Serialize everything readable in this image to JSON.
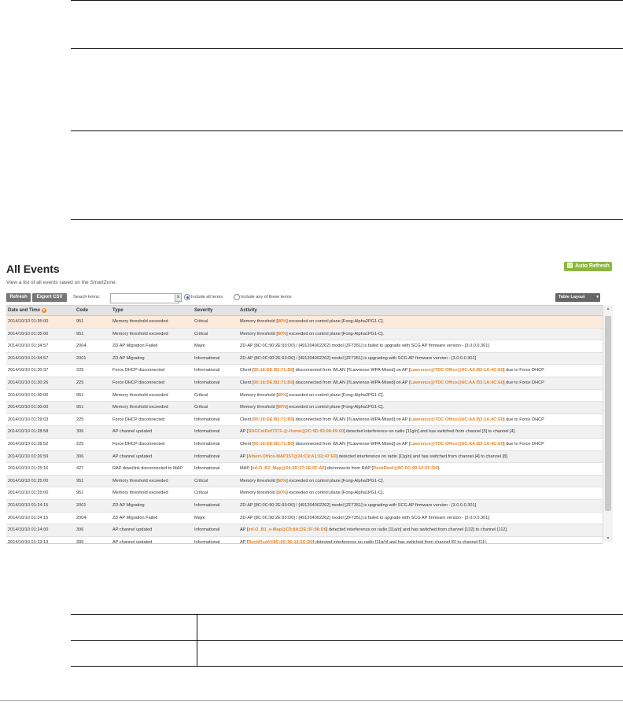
{
  "page": {
    "title": "All Events",
    "auto_refresh_label": "Auto Refresh",
    "subtitle": "View a list of all events saved on the SmartZone."
  },
  "toolbar": {
    "refresh_label": "Refresh",
    "export_label": "Export CSV",
    "search_label": "Search terms:",
    "search_value": "",
    "clear_label": "x",
    "radio_all_label": "Include all terms",
    "radio_any_label": "Include any of these terms",
    "table_layout_label": "Table Layout",
    "table_layout_caret": "▾"
  },
  "columns": [
    "Date and Time",
    "Code",
    "Type",
    "Severity",
    "Activity"
  ],
  "sort_icon_glyph": "▾",
  "rows": [
    {
      "date": "2014/10/10 01:35:00",
      "code": "951",
      "type": "Memory threshold exceeded",
      "severity": "Critical",
      "activity": [
        [
          "Memory threshold [",
          0
        ],
        [
          "80%",
          1
        ],
        [
          "] exceeded on control plane [Fong-Alpha2PG1-C].",
          0
        ]
      ]
    },
    {
      "date": "2014/10/10 01:35:00",
      "code": "951",
      "type": "Memory threshold exceeded",
      "severity": "Critical",
      "activity": [
        [
          "Memory threshold [",
          0
        ],
        [
          "80%",
          1
        ],
        [
          "] exceeded on control plane [Fong-Alpha1PG1-C].",
          0
        ]
      ]
    },
    {
      "date": "2014/10/10 01:34:57",
      "code": "2004",
      "type": "ZD AP Migration Failed",
      "severity": "Major",
      "activity": [
        [
          "ZD-AP [8C:0C:90:2E:93:D0] / [491204002262] model [ZF7351] is failed to upgrade with SCG AP firmware version - [3.0.0.0.301]",
          0
        ]
      ]
    },
    {
      "date": "2014/10/10 01:34:57",
      "code": "2001",
      "type": "ZD AP Migrating",
      "severity": "Informational",
      "activity": [
        [
          "ZD-AP [8C:0C:90:2E:93:D0] / [491204002262] model [ZF7351] is upgrading with SCG AP firmware version - [3.0.0.0.301]",
          0
        ]
      ]
    },
    {
      "date": "2014/10/10 01:30:37",
      "code": "225",
      "type": "Force DHCP disconnected",
      "severity": "Informational",
      "activity": [
        [
          "Client [",
          0
        ],
        [
          "00:18:DE:B2:71:B0",
          1
        ],
        [
          "] disconnected from WLAN [!!Lawrence-WPA-Mixed] on AP [",
          0
        ],
        [
          "Lawrence@TDC Office@6C:AA:B3:1A:4C:E0",
          1
        ],
        [
          "] due to Force DHCP",
          0
        ]
      ]
    },
    {
      "date": "2014/10/10 01:30:26",
      "code": "225",
      "type": "Force DHCP disconnected",
      "severity": "Informational",
      "activity": [
        [
          "Client [",
          0
        ],
        [
          "00:18:DE:B2:71:B0",
          1
        ],
        [
          "] disconnected from WLAN [!!Lawrence-WPA-Mixed] on AP [",
          0
        ],
        [
          "Lawrence@TDC Office@6C:AA:B3:1A:4C:E0",
          1
        ],
        [
          "] due to Force DHCP",
          0
        ]
      ]
    },
    {
      "date": "2014/10/10 01:30:00",
      "code": "951",
      "type": "Memory threshold exceeded",
      "severity": "Critical",
      "activity": [
        [
          "Memory threshold [",
          0
        ],
        [
          "80%",
          1
        ],
        [
          "] exceeded on control plane [Fong-Alpha2PG1-C].",
          0
        ]
      ]
    },
    {
      "date": "2014/10/10 01:30:00",
      "code": "951",
      "type": "Memory threshold exceeded",
      "severity": "Critical",
      "activity": [
        [
          "Memory threshold [",
          0
        ],
        [
          "80%",
          1
        ],
        [
          "] exceeded on control plane [Fong-Alpha1PG1-C].",
          0
        ]
      ]
    },
    {
      "date": "2014/10/10 01:29:03",
      "code": "225",
      "type": "Force DHCP disconnected",
      "severity": "Informational",
      "activity": [
        [
          "Client [",
          0
        ],
        [
          "00:18:DE:B2:71:B0",
          1
        ],
        [
          "] disconnected from WLAN [!!Lawrence-WPA-Mixed] on AP [",
          0
        ],
        [
          "Lawrence@TDC Office@6C:AA:B3:1A:4C:E0",
          1
        ],
        [
          "] due to Force DHCP",
          0
        ]
      ]
    },
    {
      "date": "2014/10/10 01:28:58",
      "code": "306",
      "type": "AP channel updated",
      "severity": "Informational",
      "activity": [
        [
          "AP [",
          0
        ],
        [
          "SDCCotDof7372-@-Home@2C:5D:93:08:69:00",
          1
        ],
        [
          "] detected interference on radio [11g/n] and has switched from channel [5] to channel [4].",
          0
        ]
      ]
    },
    {
      "date": "2014/10/10 01:28:52",
      "code": "225",
      "type": "Force DHCP disconnected",
      "severity": "Informational",
      "activity": [
        [
          "Client [",
          0
        ],
        [
          "00:18:DE:B2:71:B0",
          1
        ],
        [
          "] disconnected from WLAN [!!Lawrence-WPA-Mixed] on AP [",
          0
        ],
        [
          "Lawrence@TDC Office@6C:AA:B3:1A:4C:E0",
          1
        ],
        [
          "] due to Force DHCP",
          0
        ]
      ]
    },
    {
      "date": "2014/10/10 01:26:59",
      "code": "306",
      "type": "AP channel updated",
      "severity": "Informational",
      "activity": [
        [
          "AP [",
          0
        ],
        [
          "Albert-Office-MAP157@24:C9:A1:02:47:E0",
          1
        ],
        [
          "] detected interference on radio [11g/n] and has switched from channel [4] to channel [8].",
          0
        ]
      ]
    },
    {
      "date": "2014/10/10 01:25:16",
      "code": "427",
      "type": "RAP downlink disconnected to MAP",
      "severity": "Informational",
      "activity": [
        [
          "MAP [",
          0
        ],
        [
          "inf-O_B2_Map@54:3D:37:1E:5F:A6",
          1
        ],
        [
          "] disconnects from RAP [",
          0
        ],
        [
          "RuckRoof@8C:0C:90:12:2C:D0",
          1
        ],
        [
          "].",
          0
        ]
      ]
    },
    {
      "date": "2014/10/10 01:25:00",
      "code": "951",
      "type": "Memory threshold exceeded",
      "severity": "Critical",
      "activity": [
        [
          "Memory threshold [",
          0
        ],
        [
          "80%",
          1
        ],
        [
          "] exceeded on control plane [Fong-Alpha2PG1-C].",
          0
        ]
      ]
    },
    {
      "date": "2014/10/10 01:25:00",
      "code": "951",
      "type": "Memory threshold exceeded",
      "severity": "Critical",
      "activity": [
        [
          "Memory threshold [",
          0
        ],
        [
          "80%",
          1
        ],
        [
          "] exceeded on control plane [Fong-Alpha1PG1-C].",
          0
        ]
      ]
    },
    {
      "date": "2014/10/10 01:24:15",
      "code": "2001",
      "type": "ZD AP Migrating",
      "severity": "Informational",
      "activity": [
        [
          "ZD-AP [8C:0C:90:2E:93:D0] / [491204002262] model [ZF7351] is upgrading with SCG AP firmware version - [3.0.0.0.301]",
          0
        ]
      ]
    },
    {
      "date": "2014/10/10 01:24:15",
      "code": "2004",
      "type": "ZD AP Migration Failed",
      "severity": "Major",
      "activity": [
        [
          "ZD-AP [8C:0C:90:2E:93:D0] / [491204002262] model [ZF7351] is failed to upgrade with SCG AP firmware version - [3.0.0.0.301].",
          0
        ]
      ]
    },
    {
      "date": "2014/10/10 01:24:00",
      "code": "306",
      "type": "AP channel updated",
      "severity": "Informational",
      "activity": [
        [
          "AP [",
          0
        ],
        [
          "inf-O_B1_e-Map@C0:8A:DE:3F:06:D0",
          1
        ],
        [
          "] detected interference on radio [11a/n] and has switched from channel [132] to channel [112].",
          0
        ]
      ]
    },
    {
      "date": "2014/10/10 01:23:13",
      "code": "306",
      "type": "AP channel updated",
      "severity": "Informational",
      "activity": [
        [
          "AP [",
          0
        ],
        [
          "RuckRoof@8C:0C:90:12:2C:D0",
          1
        ],
        [
          "] detected interference on radio [11g/n] and has switched from channel [6] to channel [11].",
          0
        ]
      ]
    }
  ]
}
